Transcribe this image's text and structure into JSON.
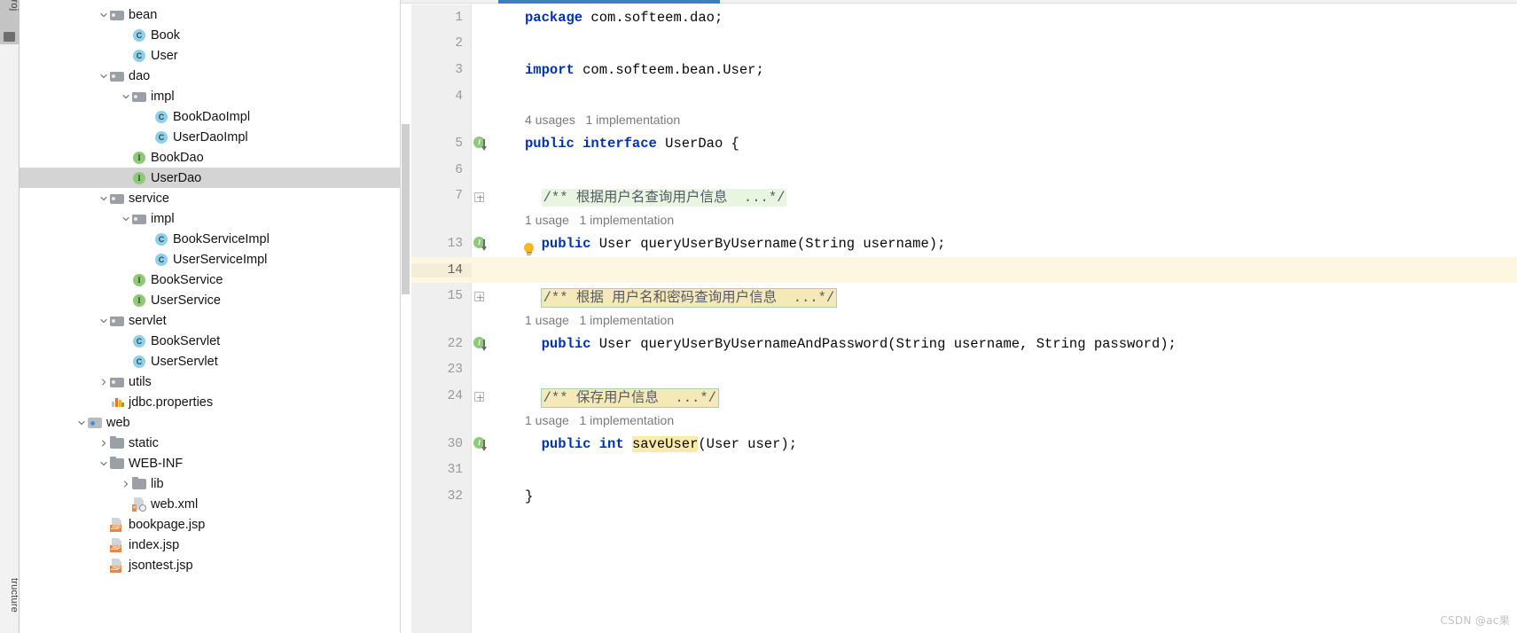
{
  "toolwindows": {
    "left_top_tab": "Proj",
    "left_bottom_tab": "tructure"
  },
  "project_tree": {
    "items": [
      {
        "label": "bean",
        "indent": 1,
        "arrow": "down",
        "icon": "folder",
        "selected": false
      },
      {
        "label": "Book",
        "indent": 2,
        "arrow": "none",
        "icon": "class",
        "selected": false
      },
      {
        "label": "User",
        "indent": 2,
        "arrow": "none",
        "icon": "class",
        "selected": false
      },
      {
        "label": "dao",
        "indent": 1,
        "arrow": "down",
        "icon": "folder",
        "selected": false
      },
      {
        "label": "impl",
        "indent": 2,
        "arrow": "down",
        "icon": "folder",
        "selected": false
      },
      {
        "label": "BookDaoImpl",
        "indent": 3,
        "arrow": "none",
        "icon": "class",
        "selected": false
      },
      {
        "label": "UserDaoImpl",
        "indent": 3,
        "arrow": "none",
        "icon": "class",
        "selected": false
      },
      {
        "label": "BookDao",
        "indent": 2,
        "arrow": "none",
        "icon": "interface",
        "selected": false
      },
      {
        "label": "UserDao",
        "indent": 2,
        "arrow": "none",
        "icon": "interface",
        "selected": true
      },
      {
        "label": "service",
        "indent": 1,
        "arrow": "down",
        "icon": "folder",
        "selected": false
      },
      {
        "label": "impl",
        "indent": 2,
        "arrow": "down",
        "icon": "folder",
        "selected": false
      },
      {
        "label": "BookServiceImpl",
        "indent": 3,
        "arrow": "none",
        "icon": "class",
        "selected": false
      },
      {
        "label": "UserServiceImpl",
        "indent": 3,
        "arrow": "none",
        "icon": "class",
        "selected": false
      },
      {
        "label": "BookService",
        "indent": 2,
        "arrow": "none",
        "icon": "interface",
        "selected": false
      },
      {
        "label": "UserService",
        "indent": 2,
        "arrow": "none",
        "icon": "interface",
        "selected": false
      },
      {
        "label": "servlet",
        "indent": 1,
        "arrow": "down",
        "icon": "folder",
        "selected": false
      },
      {
        "label": "BookServlet",
        "indent": 2,
        "arrow": "none",
        "icon": "class",
        "selected": false
      },
      {
        "label": "UserServlet",
        "indent": 2,
        "arrow": "none",
        "icon": "class",
        "selected": false
      },
      {
        "label": "utils",
        "indent": 1,
        "arrow": "right",
        "icon": "folder",
        "selected": false
      },
      {
        "label": "jdbc.properties",
        "indent": 1,
        "arrow": "none",
        "icon": "properties",
        "selected": false
      },
      {
        "label": "web",
        "indent": 0,
        "arrow": "down",
        "icon": "module",
        "selected": false
      },
      {
        "label": "static",
        "indent": 1,
        "arrow": "right",
        "icon": "folder2",
        "selected": false
      },
      {
        "label": "WEB-INF",
        "indent": 1,
        "arrow": "down",
        "icon": "folder2",
        "selected": false
      },
      {
        "label": "lib",
        "indent": 2,
        "arrow": "right",
        "icon": "folder2",
        "selected": false
      },
      {
        "label": "web.xml",
        "indent": 2,
        "arrow": "none",
        "icon": "xmlfile",
        "selected": false
      },
      {
        "label": "bookpage.jsp",
        "indent": 1,
        "arrow": "none",
        "icon": "jspfile",
        "selected": false
      },
      {
        "label": "index.jsp",
        "indent": 1,
        "arrow": "none",
        "icon": "jspfile",
        "selected": false
      },
      {
        "label": "jsontest.jsp",
        "indent": 1,
        "arrow": "none",
        "icon": "jspfile",
        "selected": false
      }
    ]
  },
  "editor": {
    "active_tab_accent": "#3d7ebd",
    "lines": [
      {
        "num": "1",
        "type": "code",
        "marker": "none",
        "fold": false,
        "bulb": false,
        "highlight": false,
        "segments": [
          {
            "t": "package",
            "c": "kw"
          },
          {
            "t": " com.softeem.dao;",
            "c": "plain"
          }
        ]
      },
      {
        "num": "2",
        "type": "code",
        "marker": "none",
        "fold": false,
        "bulb": false,
        "highlight": false,
        "segments": []
      },
      {
        "num": "3",
        "type": "code",
        "marker": "none",
        "fold": false,
        "bulb": false,
        "highlight": false,
        "segments": [
          {
            "t": "import",
            "c": "kw"
          },
          {
            "t": " com.softeem.bean.User;",
            "c": "plain"
          }
        ]
      },
      {
        "num": "4",
        "type": "code",
        "marker": "none",
        "fold": false,
        "bulb": false,
        "highlight": false,
        "segments": []
      },
      {
        "num": "",
        "type": "hint",
        "text": "4 usages   1 implementation"
      },
      {
        "num": "5",
        "type": "code",
        "marker": "impl",
        "fold": false,
        "bulb": false,
        "highlight": false,
        "segments": [
          {
            "t": "public",
            "c": "kw"
          },
          {
            "t": " ",
            "c": "plain"
          },
          {
            "t": "interface",
            "c": "kw"
          },
          {
            "t": " UserDao {",
            "c": "plain"
          }
        ]
      },
      {
        "num": "6",
        "type": "code",
        "marker": "none",
        "fold": false,
        "bulb": false,
        "highlight": false,
        "segments": []
      },
      {
        "num": "7",
        "type": "code",
        "marker": "none",
        "fold": true,
        "bulb": false,
        "highlight": false,
        "segments": [
          {
            "t": "  ",
            "c": "plain"
          },
          {
            "t": "/** 根据用户名查询用户信息  ...*/",
            "c": "cmt hl-green"
          }
        ]
      },
      {
        "num": "",
        "type": "hint",
        "text": "1 usage   1 implementation"
      },
      {
        "num": "13",
        "type": "code",
        "marker": "impl",
        "fold": false,
        "bulb": true,
        "highlight": false,
        "segments": [
          {
            "t": "  ",
            "c": "plain"
          },
          {
            "t": "public",
            "c": "kw"
          },
          {
            "t": " User queryUserByUsername(String username);",
            "c": "plain"
          }
        ]
      },
      {
        "num": "14",
        "type": "code",
        "marker": "none",
        "fold": false,
        "bulb": false,
        "highlight": true,
        "segments": []
      },
      {
        "num": "15",
        "type": "code",
        "marker": "none",
        "fold": true,
        "bulb": false,
        "highlight": false,
        "segments": [
          {
            "t": "  ",
            "c": "plain"
          },
          {
            "t": "/** 根据 用户名和密码查询用户信息  ...*/",
            "c": "cmt hl-yellow"
          }
        ]
      },
      {
        "num": "",
        "type": "hint",
        "text": "1 usage   1 implementation"
      },
      {
        "num": "22",
        "type": "code",
        "marker": "impl",
        "fold": false,
        "bulb": false,
        "highlight": false,
        "segments": [
          {
            "t": "  ",
            "c": "plain"
          },
          {
            "t": "public",
            "c": "kw"
          },
          {
            "t": " User queryUserByUsernameAndPassword(String username, String password);",
            "c": "plain"
          }
        ]
      },
      {
        "num": "23",
        "type": "code",
        "marker": "none",
        "fold": false,
        "bulb": false,
        "highlight": false,
        "segments": []
      },
      {
        "num": "24",
        "type": "code",
        "marker": "none",
        "fold": true,
        "bulb": false,
        "highlight": false,
        "segments": [
          {
            "t": "  ",
            "c": "plain"
          },
          {
            "t": "/** 保存用户信息  ...*/",
            "c": "cmt hl-yellow"
          }
        ]
      },
      {
        "num": "",
        "type": "hint",
        "text": "1 usage   1 implementation"
      },
      {
        "num": "30",
        "type": "code",
        "marker": "impl",
        "fold": false,
        "bulb": false,
        "highlight": false,
        "segments": [
          {
            "t": "  ",
            "c": "plain"
          },
          {
            "t": "public",
            "c": "kw"
          },
          {
            "t": " ",
            "c": "plain"
          },
          {
            "t": "int",
            "c": "kw"
          },
          {
            "t": " ",
            "c": "plain"
          },
          {
            "t": "saveUser",
            "c": "plain hl-ident"
          },
          {
            "t": "(User user);",
            "c": "plain"
          }
        ]
      },
      {
        "num": "31",
        "type": "code",
        "marker": "none",
        "fold": false,
        "bulb": false,
        "highlight": false,
        "segments": []
      },
      {
        "num": "32",
        "type": "code",
        "marker": "none",
        "fold": false,
        "bulb": false,
        "highlight": false,
        "segments": [
          {
            "t": "}",
            "c": "plain"
          }
        ]
      }
    ]
  },
  "watermark": "CSDN @ac果"
}
